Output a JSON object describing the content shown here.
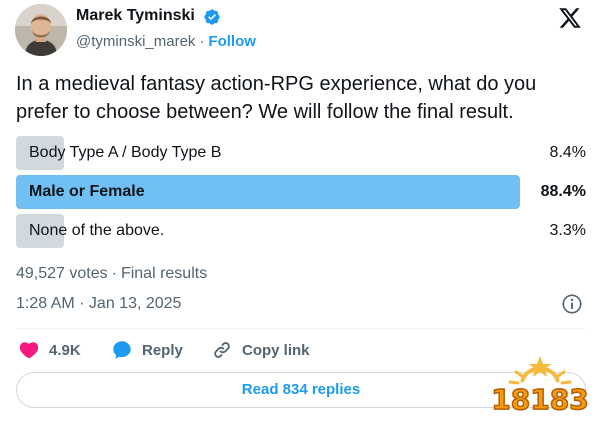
{
  "author": {
    "name": "Marek Tyminski",
    "handle": "@tyminski_marek",
    "separator": "·",
    "follow_label": "Follow",
    "verified_icon": "verified-badge-icon",
    "avatar": "avatar-photo"
  },
  "platform_icon": "x-logo-icon",
  "tweet": {
    "text": "In a medieval fantasy action-RPG experience, what do you prefer to choose between? We will follow the final result."
  },
  "poll": {
    "options": [
      {
        "label": "Body Type A / Body Type B",
        "percent_label": "8.4%",
        "percent": 8.4,
        "winner": false
      },
      {
        "label": "Male or Female",
        "percent_label": "88.4%",
        "percent": 88.4,
        "winner": true
      },
      {
        "label": "None of the above.",
        "percent_label": "3.3%",
        "percent": 3.3,
        "winner": false
      }
    ],
    "votes": "49,527 votes",
    "separator": "·",
    "status": "Final results"
  },
  "timestamp": "1:28 AM · Jan 13, 2025",
  "info_icon": "info-icon",
  "actions": {
    "like_count": "4.9K",
    "reply_label": "Reply",
    "copy_link_label": "Copy link"
  },
  "read_replies_label": "Read 834 replies",
  "watermark": {
    "text": "18183"
  },
  "colors": {
    "accent": "#1d9bf0",
    "poll_winner": "#71c0f5",
    "poll_other": "#cfd9de",
    "like": "#f91880",
    "secondary_text": "#536471"
  }
}
